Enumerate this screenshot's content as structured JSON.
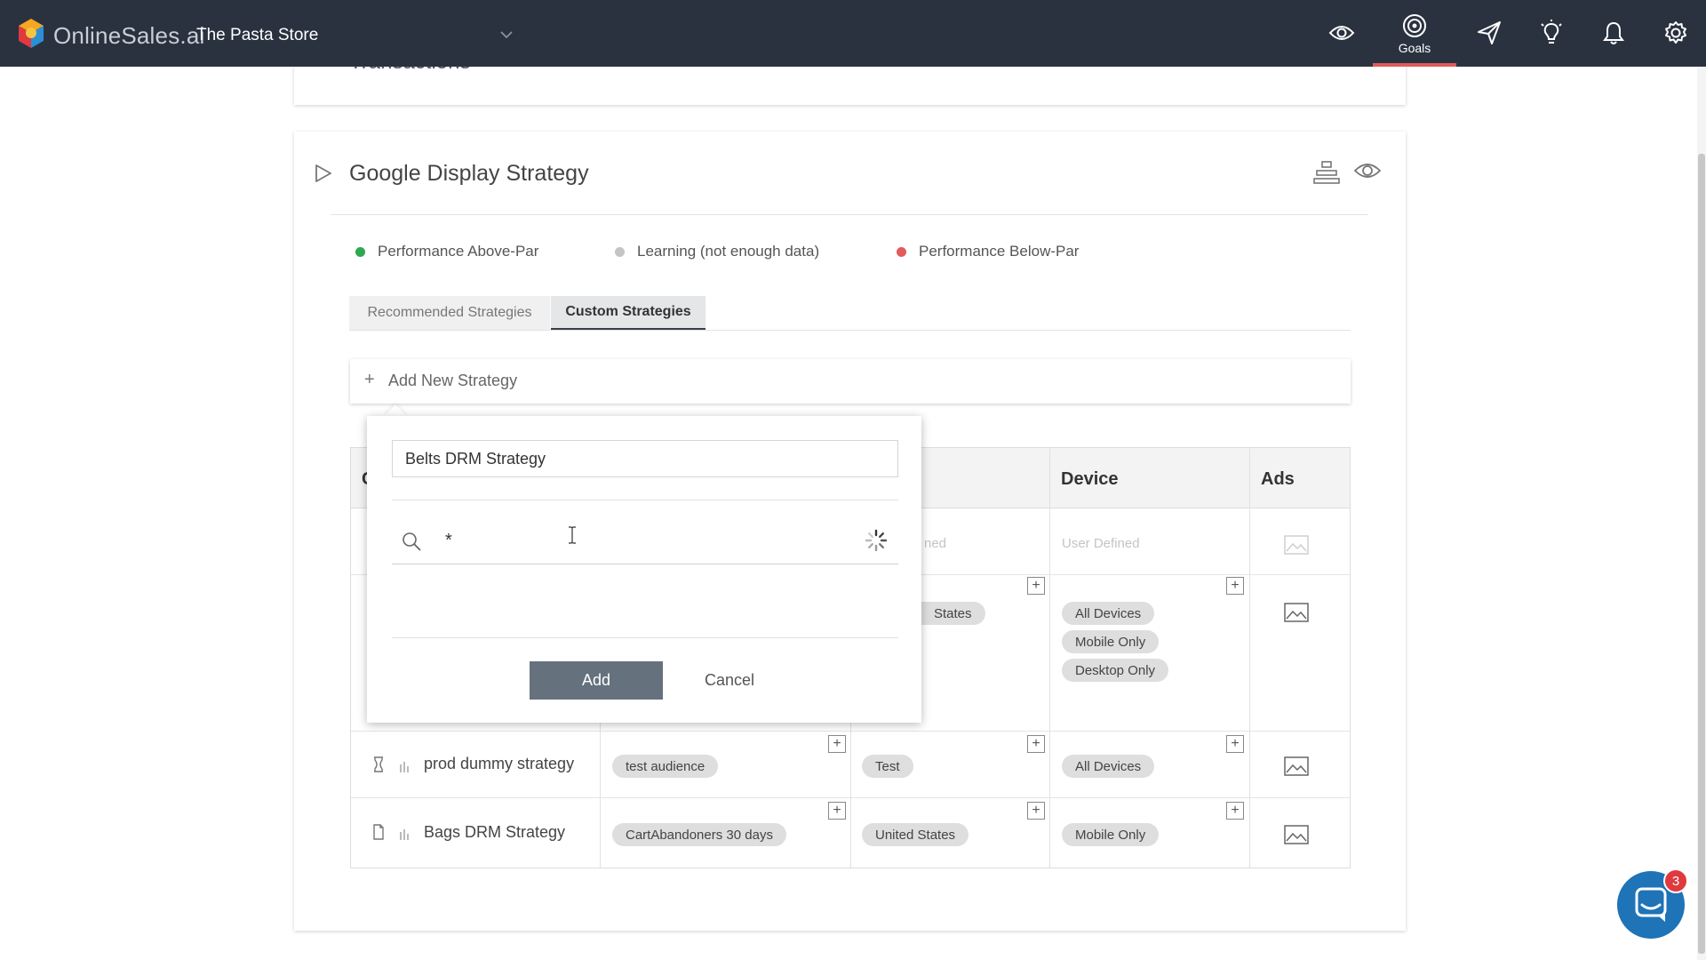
{
  "header": {
    "brand": "OnlineSales.ai",
    "store_name": "The Pasta Store",
    "nav": {
      "goals_label": "Goals"
    }
  },
  "top_card": {
    "partial_title": "Transactions"
  },
  "strategy_section": {
    "title": "Google Display Strategy",
    "legend": [
      {
        "label": "Performance Above-Par",
        "color": "#2fa84f"
      },
      {
        "label": "Learning (not enough data)",
        "color": "#c4c4c4"
      },
      {
        "label": "Performance Below-Par",
        "color": "#e35b5b"
      }
    ],
    "tabs": [
      {
        "label": "Recommended Strategies",
        "active": false
      },
      {
        "label": "Custom Strategies",
        "active": true
      }
    ],
    "add_new_label": "Add New Strategy",
    "table": {
      "headers": {
        "col1_partial": "C",
        "device": "Device",
        "ads": "Ads"
      },
      "placeholder_row": {
        "location_partial": "ned",
        "device": "User Defined"
      },
      "row_user_defined": {
        "location_partial": "States",
        "devices": [
          "All Devices",
          "Mobile Only",
          "Desktop Only"
        ]
      },
      "rows": [
        {
          "name": "prod dummy strategy",
          "audience": "test audience",
          "location": "Test",
          "device": "All Devices"
        },
        {
          "name": "Bags DRM Strategy",
          "audience": "CartAbandoners 30 days",
          "location": "United States",
          "device": "Mobile Only"
        }
      ]
    }
  },
  "popup": {
    "strategy_name": "Belts DRM Strategy",
    "search_value": "*",
    "add_label": "Add",
    "cancel_label": "Cancel"
  },
  "chat": {
    "badge_count": "3"
  },
  "colors": {
    "topbar": "#2a3240",
    "accent": "#e05a5a",
    "primary_button": "#65717d",
    "chat": "#1f73b7"
  }
}
